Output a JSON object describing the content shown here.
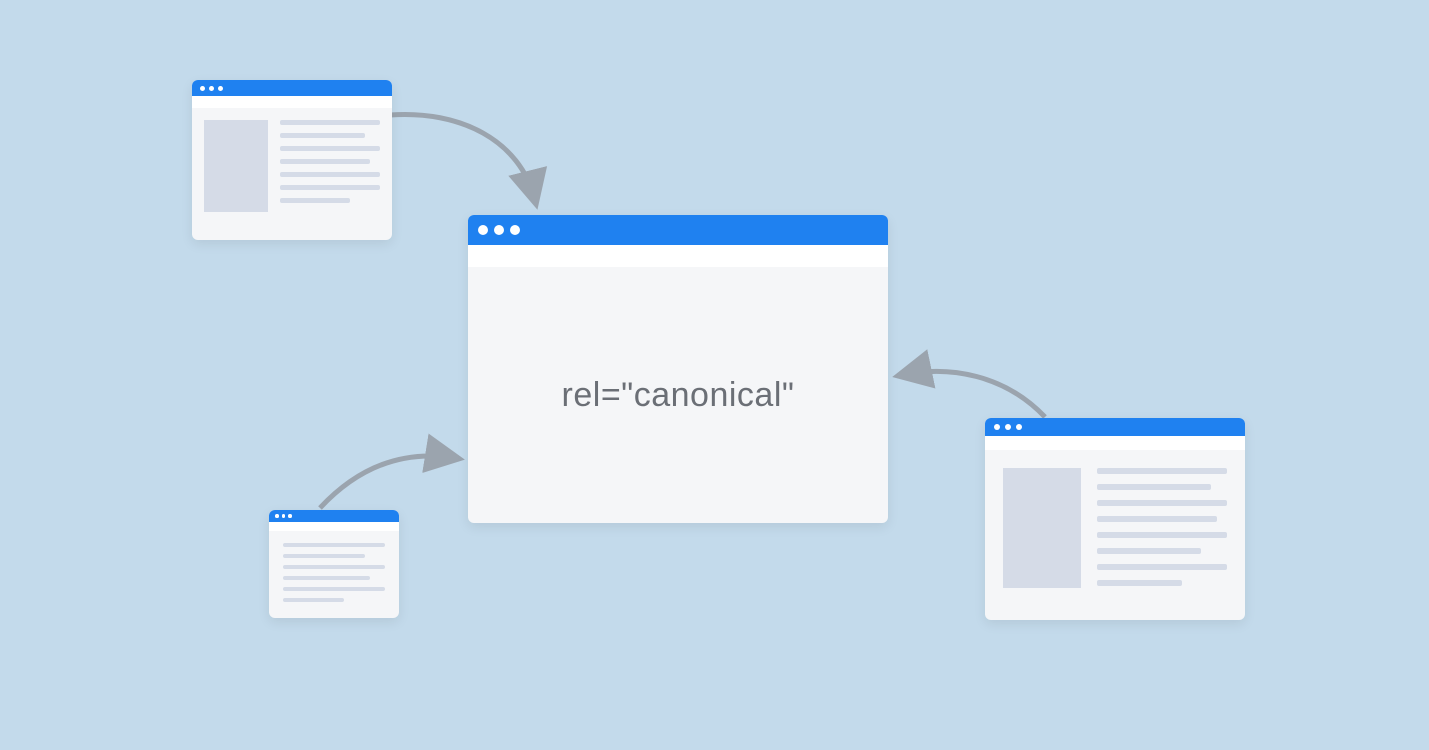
{
  "diagram": {
    "concept": "canonical-link-relation",
    "main_text": "rel=\"canonical\"",
    "colors": {
      "background": "#c3daeb",
      "titlebar": "#1f81f0",
      "window": "#f5f6f8",
      "placeholder": "#d5dbe7",
      "arrow": "#9ba4ae",
      "text": "#6b6f76"
    },
    "windows": {
      "main": {
        "role": "canonical-target"
      },
      "top_left": {
        "role": "duplicate-source"
      },
      "bottom_left": {
        "role": "duplicate-source"
      },
      "bottom_right": {
        "role": "duplicate-source"
      }
    },
    "arrows": [
      {
        "from": "top_left",
        "to": "main"
      },
      {
        "from": "bottom_left",
        "to": "main"
      },
      {
        "from": "bottom_right",
        "to": "main"
      }
    ]
  }
}
